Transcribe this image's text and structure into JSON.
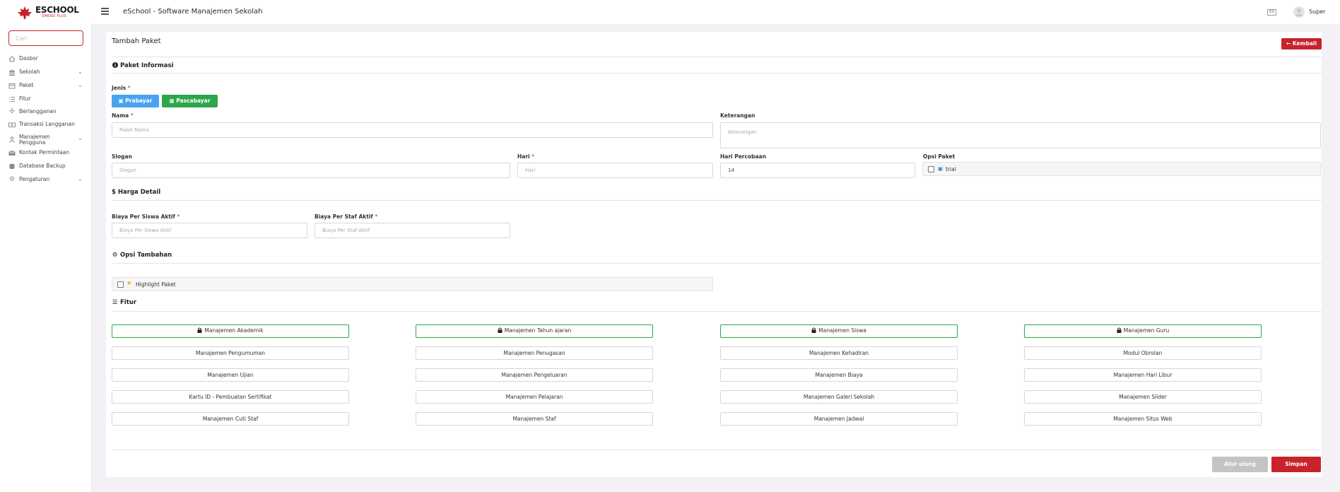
{
  "header": {
    "logo_name": "ESCHOOL",
    "logo_sub": "SMKAD PLUS",
    "title": "eSchool - Software Manajemen Sekolah",
    "lang_icon_text": "EN",
    "user_name": "Super"
  },
  "sidebar": {
    "search_placeholder": "Cari",
    "items": [
      {
        "label": "Dasbor",
        "icon": "home-icon",
        "has_chevron": false
      },
      {
        "label": "Sekolah",
        "icon": "school-icon",
        "has_chevron": true
      },
      {
        "label": "Paket",
        "icon": "package-icon",
        "has_chevron": true
      },
      {
        "label": "Fitur",
        "icon": "list-icon",
        "has_chevron": false
      },
      {
        "label": "Berlangganan",
        "icon": "subscription-icon",
        "has_chevron": false
      },
      {
        "label": "Transaksi Langganan",
        "icon": "transaction-icon",
        "has_chevron": false
      },
      {
        "label": "Manajemen",
        "label2": "Pengguna",
        "icon": "users-icon",
        "has_chevron": true
      },
      {
        "label": "Kontak Permintaan",
        "icon": "contact-icon",
        "has_chevron": false
      },
      {
        "label": "Database Backup",
        "icon": "database-icon",
        "has_chevron": false
      },
      {
        "label": "Pengaturan",
        "icon": "gear-icon",
        "has_chevron": true
      }
    ]
  },
  "page": {
    "title": "Tambah Paket",
    "back_label": "Kembali"
  },
  "sections": {
    "info": "Paket Informasi",
    "price": "Harga Detail",
    "extra": "Opsi Tambahan",
    "features": "Fitur"
  },
  "form": {
    "type_label": "Jenis",
    "prepaid_label": "Prabayar",
    "postpaid_label": "Pascabayar",
    "name_label": "Nama",
    "name_placeholder": "Paket Nama",
    "desc_label": "Keterangan",
    "desc_placeholder": "Keterangan",
    "slogan_label": "Slogan",
    "slogan_placeholder": "Slogan",
    "days_label": "Hari",
    "days_placeholder": "Hari",
    "trial_days_label": "Hari Percobaan",
    "trial_days_value": "14",
    "package_option_label": "Opsi Paket",
    "trial_option_label": "trial",
    "student_cost_label": "Biaya Per Siswa Aktif",
    "student_cost_placeholder": "Biaya Per Siswa Aktif",
    "staff_cost_label": "Biaya Per Staf Aktif",
    "staff_cost_placeholder": "Biaya Per Staf Aktif",
    "highlight_label": "Highlight Paket"
  },
  "features": [
    {
      "label": "Manajemen Akademik",
      "locked": true
    },
    {
      "label": "Manajemen Tahun ajaran",
      "locked": true
    },
    {
      "label": "Manajemen Siswa",
      "locked": true
    },
    {
      "label": "Manajemen Guru",
      "locked": true
    },
    {
      "label": "Manajemen Pengumuman",
      "locked": false
    },
    {
      "label": "Manajemen Penugasan",
      "locked": false
    },
    {
      "label": "Manajemen Kehadiran",
      "locked": false
    },
    {
      "label": "Modul Obrolan",
      "locked": false
    },
    {
      "label": "Manajemen Ujian",
      "locked": false
    },
    {
      "label": "Manajemen Pengeluaran",
      "locked": false
    },
    {
      "label": "Manajemen Biaya",
      "locked": false
    },
    {
      "label": "Manajemen Hari Libur",
      "locked": false
    },
    {
      "label": "Kartu ID - Pembuatan Sertifikat",
      "locked": false
    },
    {
      "label": "Manajemen Pelajaran",
      "locked": false
    },
    {
      "label": "Manajemen Galeri Sekolah",
      "locked": false
    },
    {
      "label": "Manajemen Slider",
      "locked": false
    },
    {
      "label": "Manajemen Cuti Staf",
      "locked": false
    },
    {
      "label": "Manajemen Staf",
      "locked": false
    },
    {
      "label": "Manajemen Jadwal",
      "locked": false
    },
    {
      "label": "Manajemen Situs Web",
      "locked": false
    }
  ],
  "actions": {
    "reset_label": "Atur ulang",
    "save_label": "Simpan"
  },
  "colors": {
    "primary": "#c8232c",
    "prepaid": "#4aa3f0",
    "postpaid": "#2ea64a",
    "locked_border": "#2ea64a"
  }
}
